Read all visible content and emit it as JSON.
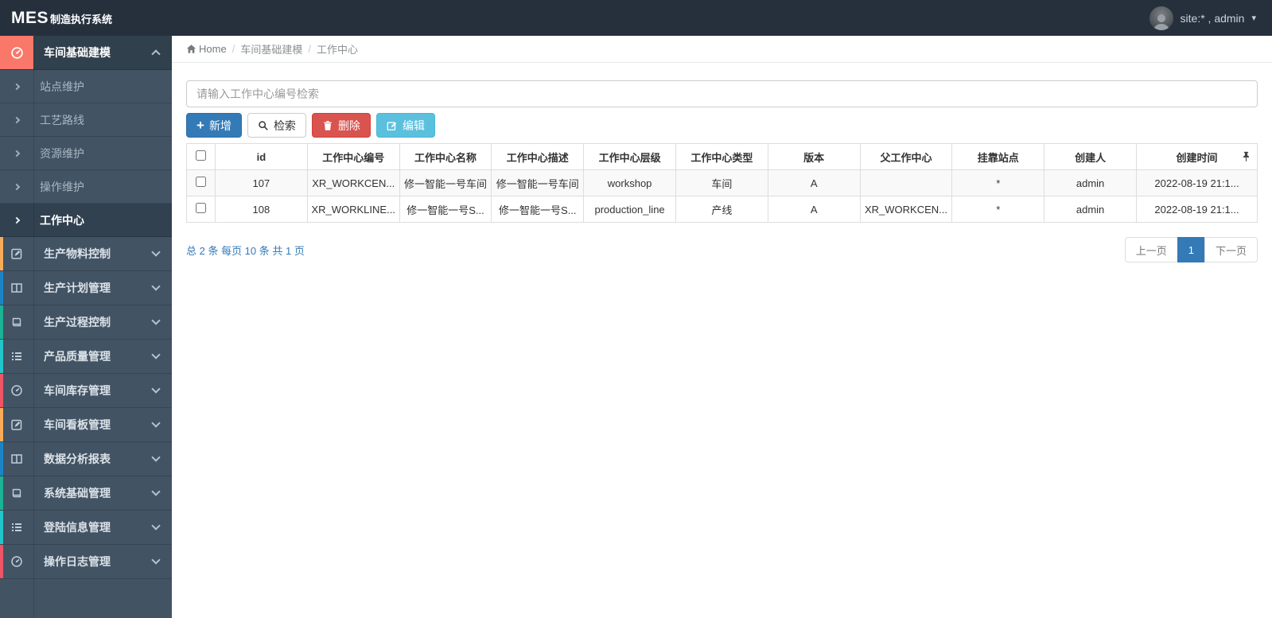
{
  "topbar": {
    "logo_mes": "MES",
    "logo_suffix": "制造执行系统",
    "user_label": "site:* , admin"
  },
  "breadcrumb": {
    "home": "Home",
    "level1": "车间基础建模",
    "level2": "工作中心"
  },
  "sidebar": {
    "active_group_label": "车间基础建模",
    "submenu": [
      "站点维护",
      "工艺路线",
      "资源维护",
      "操作维护",
      "工作中心"
    ],
    "active_submenu": "工作中心",
    "groups": [
      {
        "label": "生产物料控制",
        "icon": "pencil-square-icon",
        "accent": "#f8ac59"
      },
      {
        "label": "生产计划管理",
        "icon": "columns-icon",
        "accent": "#1c84c6"
      },
      {
        "label": "生产过程控制",
        "icon": "book-icon",
        "accent": "#1ab394"
      },
      {
        "label": "产品质量管理",
        "icon": "list-icon",
        "accent": "#23c6c8"
      },
      {
        "label": "车间库存管理",
        "icon": "dashboard-icon",
        "accent": "#ed5565"
      },
      {
        "label": "车间看板管理",
        "icon": "pencil-square-icon",
        "accent": "#f8ac59"
      },
      {
        "label": "数据分析报表",
        "icon": "columns-icon",
        "accent": "#1c84c6"
      },
      {
        "label": "系统基础管理",
        "icon": "book-icon",
        "accent": "#1ab394"
      },
      {
        "label": "登陆信息管理",
        "icon": "list-icon",
        "accent": "#23c6c8"
      },
      {
        "label": "操作日志管理",
        "icon": "dashboard-icon",
        "accent": "#ed5565"
      }
    ]
  },
  "toolbar": {
    "search_placeholder": "请输入工作中心编号检索",
    "add_label": "新增",
    "search_label": "检索",
    "delete_label": "删除",
    "edit_label": "编辑"
  },
  "table": {
    "columns": [
      "id",
      "工作中心编号",
      "工作中心名称",
      "工作中心描述",
      "工作中心层级",
      "工作中心类型",
      "版本",
      "父工作中心",
      "挂靠站点",
      "创建人",
      "创建时间"
    ],
    "rows": [
      {
        "id": "107",
        "code": "XR_WORKCEN...",
        "name": "修一智能一号车间",
        "desc": "修一智能一号车间",
        "level": "workshop",
        "type": "车间",
        "version": "A",
        "parent": "",
        "station": "*",
        "creator": "admin",
        "created": "2022-08-19 21:1..."
      },
      {
        "id": "108",
        "code": "XR_WORKLINE...",
        "name": "修一智能一号S...",
        "desc": "修一智能一号S...",
        "level": "production_line",
        "type": "产线",
        "version": "A",
        "parent": "XR_WORKCEN...",
        "station": "*",
        "creator": "admin",
        "created": "2022-08-19 21:1..."
      }
    ]
  },
  "pagination": {
    "summary": "总 2 条 每页 10 条 共 1 页",
    "prev": "上一页",
    "current": "1",
    "next": "下一页"
  },
  "colors": {
    "topbar_bg": "#26303d",
    "sidebar_bg": "#425364",
    "active_icon_block": "#f9786a",
    "primary": "#337ab7",
    "danger": "#d9534f",
    "info": "#5bc0de",
    "accent_yellow": "#f8ac59",
    "accent_blue": "#1c84c6",
    "accent_green": "#1ab394",
    "accent_teal": "#23c6c8",
    "accent_red": "#ed5565"
  }
}
